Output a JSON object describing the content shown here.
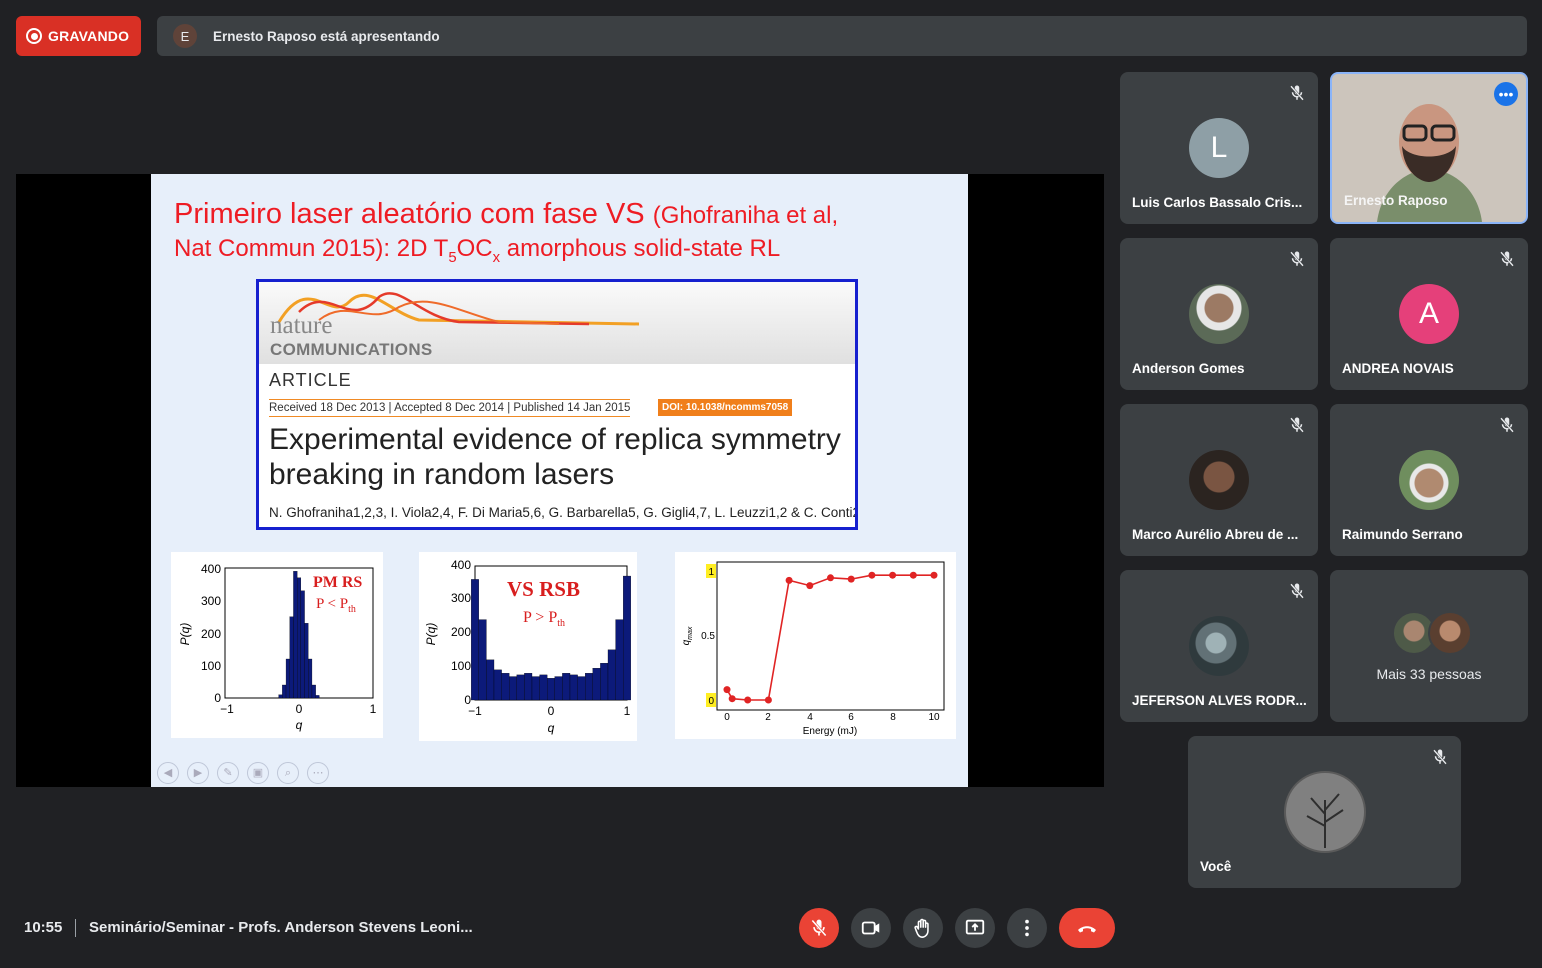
{
  "recording": {
    "label": "GRAVANDO"
  },
  "presenter": {
    "initial": "E",
    "text": "Ernesto Raposo está apresentando"
  },
  "slide": {
    "title_main": "Primeiro laser aleatório com fase VS",
    "title_ref": "(Ghofraniha et al,",
    "title2_a": "Nat Commun 2015): 2D T",
    "title2_sub1": "5",
    "title2_b": "OC",
    "title2_sub2": "x",
    "title2_c": " amorphous solid-state RL",
    "nature": "nature",
    "communications": "COMMUNICATIONS",
    "article": "ARTICLE",
    "dates": "Received 18 Dec 2013 | Accepted 8 Dec 2014 | Published 14 Jan 2015",
    "doi": "DOI: 10.1038/ncomms7058",
    "paper_title": "Experimental evidence of replica symmetry breaking in random lasers",
    "authors": "N. Ghofraniha1,2,3, I. Viola2,4, F. Di Maria5,6, G. Barbarella5, G. Gigli4,7, L. Leuzzi1,2 & C. Conti2,3",
    "plot1": {
      "label_a": "PM RS",
      "label_b": "P < P",
      "label_sub": "th",
      "ylabel": "P(q)",
      "xlabel": "q",
      "yticks": [
        "400",
        "300",
        "200",
        "100",
        "0"
      ],
      "xticks": [
        "−1",
        "0",
        "1"
      ]
    },
    "plot2": {
      "label_a": "VS RSB",
      "label_b": "P > P",
      "label_sub": "th",
      "ylabel": "P(q)",
      "xlabel": "q",
      "yticks": [
        "400",
        "300",
        "200",
        "100",
        "0"
      ],
      "xticks": [
        "−1",
        "0",
        "1"
      ]
    },
    "plot3": {
      "ylabel": "q",
      "ylabel_sub": "max",
      "xlabel": "Energy (mJ)",
      "yticks": [
        "1",
        "0.5",
        "0"
      ],
      "xticks": [
        "0",
        "2",
        "4",
        "6",
        "8",
        "10"
      ]
    }
  },
  "chart_data": [
    {
      "type": "bar",
      "title": "",
      "xlabel": "q",
      "ylabel": "P(q)",
      "ylim": [
        0,
        400
      ],
      "xlim": [
        -1,
        1
      ],
      "x": [
        -0.25,
        -0.2,
        -0.15,
        -0.1,
        -0.05,
        0,
        0.05,
        0.1,
        0.15,
        0.2,
        0.25
      ],
      "values": [
        10,
        40,
        120,
        250,
        390,
        370,
        330,
        230,
        120,
        40,
        8
      ]
    },
    {
      "type": "bar",
      "title": "",
      "xlabel": "q",
      "ylabel": "P(q)",
      "ylim": [
        0,
        400
      ],
      "xlim": [
        -1,
        1
      ],
      "x": [
        -1,
        -0.9,
        -0.8,
        -0.7,
        -0.6,
        -0.5,
        -0.4,
        -0.3,
        -0.2,
        -0.1,
        0,
        0.1,
        0.2,
        0.3,
        0.4,
        0.5,
        0.6,
        0.7,
        0.8,
        0.9,
        1
      ],
      "values": [
        360,
        240,
        120,
        90,
        80,
        70,
        75,
        80,
        70,
        75,
        65,
        70,
        80,
        75,
        70,
        80,
        95,
        110,
        150,
        240,
        370
      ]
    },
    {
      "type": "line",
      "title": "",
      "xlabel": "Energy (mJ)",
      "ylabel": "q_max",
      "ylim": [
        0,
        1
      ],
      "xlim": [
        0,
        10
      ],
      "x": [
        0,
        0.25,
        1,
        2,
        3,
        4,
        5,
        6,
        7,
        8,
        9,
        10
      ],
      "values": [
        0.08,
        0.01,
        0.0,
        0.0,
        0.92,
        0.88,
        0.94,
        0.93,
        0.96,
        0.96,
        0.96,
        0.96
      ]
    }
  ],
  "participants": [
    {
      "name": "Luis Carlos Bassalo Cris...",
      "initial": "L",
      "color": "#8e9fa6"
    },
    {
      "name": "Ernesto Raposo"
    },
    {
      "name": "Anderson Gomes"
    },
    {
      "name": "ANDREA NOVAIS",
      "initial": "A",
      "color": "#e5407a"
    },
    {
      "name": "Marco Aurélio Abreu de ..."
    },
    {
      "name": "Raimundo Serrano"
    },
    {
      "name": "JEFERSON ALVES RODR..."
    },
    {
      "name": "Mais 33 pessoas"
    },
    {
      "name": "Você"
    }
  ],
  "meeting": {
    "time": "10:55",
    "title": "Seminário/Seminar - Profs. Anderson Stevens Leoni..."
  },
  "colors": {
    "accent_red": "#ea4335",
    "tile": "#3c4043",
    "background": "#202124"
  }
}
